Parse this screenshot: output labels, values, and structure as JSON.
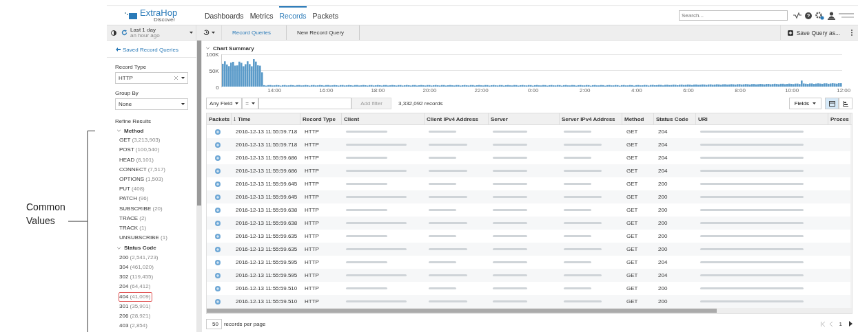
{
  "annotation": {
    "label": "Common\nValues"
  },
  "header": {
    "logo": {
      "name": "ExtraHop",
      "sub": "Discover"
    },
    "nav": [
      {
        "label": "Dashboards",
        "selected": false
      },
      {
        "label": "Metrics",
        "selected": false
      },
      {
        "label": "Records",
        "selected": true
      },
      {
        "label": "Packets",
        "selected": false
      }
    ],
    "search": {
      "placeholder": "Search..."
    }
  },
  "toolbar": {
    "time_range": "Last 1 day",
    "time_sub": "an hour ago",
    "breadcrumbs": [
      {
        "label": "Record Queries",
        "kind": "link"
      },
      {
        "label": "New Record Query",
        "kind": "current"
      }
    ],
    "save_button": "Save Query as..."
  },
  "sidebar": {
    "back_link": "Saved Record Queries",
    "record_type": {
      "label": "Record Type",
      "value": "HTTP"
    },
    "group_by": {
      "label": "Group By",
      "value": "None"
    },
    "refine_title": "Refine Results",
    "groups": [
      {
        "title": "Method",
        "expanded": true,
        "items": [
          {
            "value": "GET",
            "count": "(3,213,903)",
            "highlighted": false
          },
          {
            "value": "POST",
            "count": "(100,540)",
            "highlighted": false
          },
          {
            "value": "HEAD",
            "count": "(8,101)",
            "highlighted": false
          },
          {
            "value": "CONNECT",
            "count": "(7,517)",
            "highlighted": false
          },
          {
            "value": "OPTIONS",
            "count": "(1,503)",
            "highlighted": false
          },
          {
            "value": "PUT",
            "count": "(408)",
            "highlighted": false
          },
          {
            "value": "PATCH",
            "count": "(96)",
            "highlighted": false
          },
          {
            "value": "SUBSCRIBE",
            "count": "(20)",
            "highlighted": false
          },
          {
            "value": "TRACE",
            "count": "(2)",
            "highlighted": false
          },
          {
            "value": "TRACK",
            "count": "(1)",
            "highlighted": false
          },
          {
            "value": "UNSUBSCRIBE",
            "count": "(1)",
            "highlighted": false
          }
        ]
      },
      {
        "title": "Status Code",
        "expanded": true,
        "items": [
          {
            "value": "200",
            "count": "(2,541,723)",
            "highlighted": false
          },
          {
            "value": "304",
            "count": "(461,020)",
            "highlighted": false
          },
          {
            "value": "302",
            "count": "(119,455)",
            "highlighted": false
          },
          {
            "value": "204",
            "count": "(64,412)",
            "highlighted": false
          },
          {
            "value": "404",
            "count": "(41,009)",
            "highlighted": true
          },
          {
            "value": "301",
            "count": "(35,901)",
            "highlighted": false
          },
          {
            "value": "206",
            "count": "(28,921)",
            "highlighted": false
          },
          {
            "value": "403",
            "count": "(2,854)",
            "highlighted": false
          }
        ]
      }
    ]
  },
  "chart": {
    "title": "Chart Summary",
    "expanded": true,
    "y_ticks": [
      "100K",
      "50K",
      "0"
    ],
    "x_labels": [
      "14:00",
      "16:00",
      "18:00",
      "20:00",
      "22:00",
      "0:00",
      "2:00",
      "4:00",
      "6:00",
      "8:00",
      "10:00",
      "12:00"
    ]
  },
  "filter": {
    "field": "Any Field",
    "operator": "=",
    "add_button": "Add filter",
    "count": "3,332,092 records",
    "fields_button": "Fields",
    "views": [
      {
        "kind": "table",
        "selected": true
      },
      {
        "kind": "chart",
        "selected": false
      }
    ]
  },
  "table": {
    "columns": [
      "Packets",
      "Time",
      "Record Type",
      "Client",
      "Client IPv4 Address",
      "Server",
      "Server IPv4 Address",
      "Method",
      "Status Code",
      "URI",
      "Proces"
    ],
    "rows": [
      {
        "time": "2016-12-13 11:55:59.718",
        "record_type": "HTTP",
        "method": "GET",
        "status_code": "204"
      },
      {
        "time": "2016-12-13 11:55:59.718",
        "record_type": "HTTP",
        "method": "GET",
        "status_code": "204"
      },
      {
        "time": "2016-12-13 11:55:59.686",
        "record_type": "HTTP",
        "method": "GET",
        "status_code": "204"
      },
      {
        "time": "2016-12-13 11:55:59.686",
        "record_type": "HTTP",
        "method": "GET",
        "status_code": "204"
      },
      {
        "time": "2016-12-13 11:55:59.645",
        "record_type": "HTTP",
        "method": "GET",
        "status_code": "200"
      },
      {
        "time": "2016-12-13 11:55:59.645",
        "record_type": "HTTP",
        "method": "GET",
        "status_code": "200"
      },
      {
        "time": "2016-12-13 11:55:59.638",
        "record_type": "HTTP",
        "method": "GET",
        "status_code": "200"
      },
      {
        "time": "2016-12-13 11:55:59.638",
        "record_type": "HTTP",
        "method": "GET",
        "status_code": "200"
      },
      {
        "time": "2016-12-13 11:55:59.635",
        "record_type": "HTTP",
        "method": "GET",
        "status_code": "200"
      },
      {
        "time": "2016-12-13 11:55:59.635",
        "record_type": "HTTP",
        "method": "GET",
        "status_code": "200"
      },
      {
        "time": "2016-12-13 11:55:59.595",
        "record_type": "HTTP",
        "method": "GET",
        "status_code": "204"
      },
      {
        "time": "2016-12-13 11:55:59.595",
        "record_type": "HTTP",
        "method": "GET",
        "status_code": "204"
      },
      {
        "time": "2016-12-13 11:55:59.510",
        "record_type": "HTTP",
        "method": "GET",
        "status_code": "200"
      },
      {
        "time": "2016-12-13 11:55:59.510",
        "record_type": "HTTP",
        "method": "GET",
        "status_code": "200"
      }
    ]
  },
  "footer": {
    "per_page": "50",
    "per_page_label": "records per page",
    "page": "1"
  }
}
